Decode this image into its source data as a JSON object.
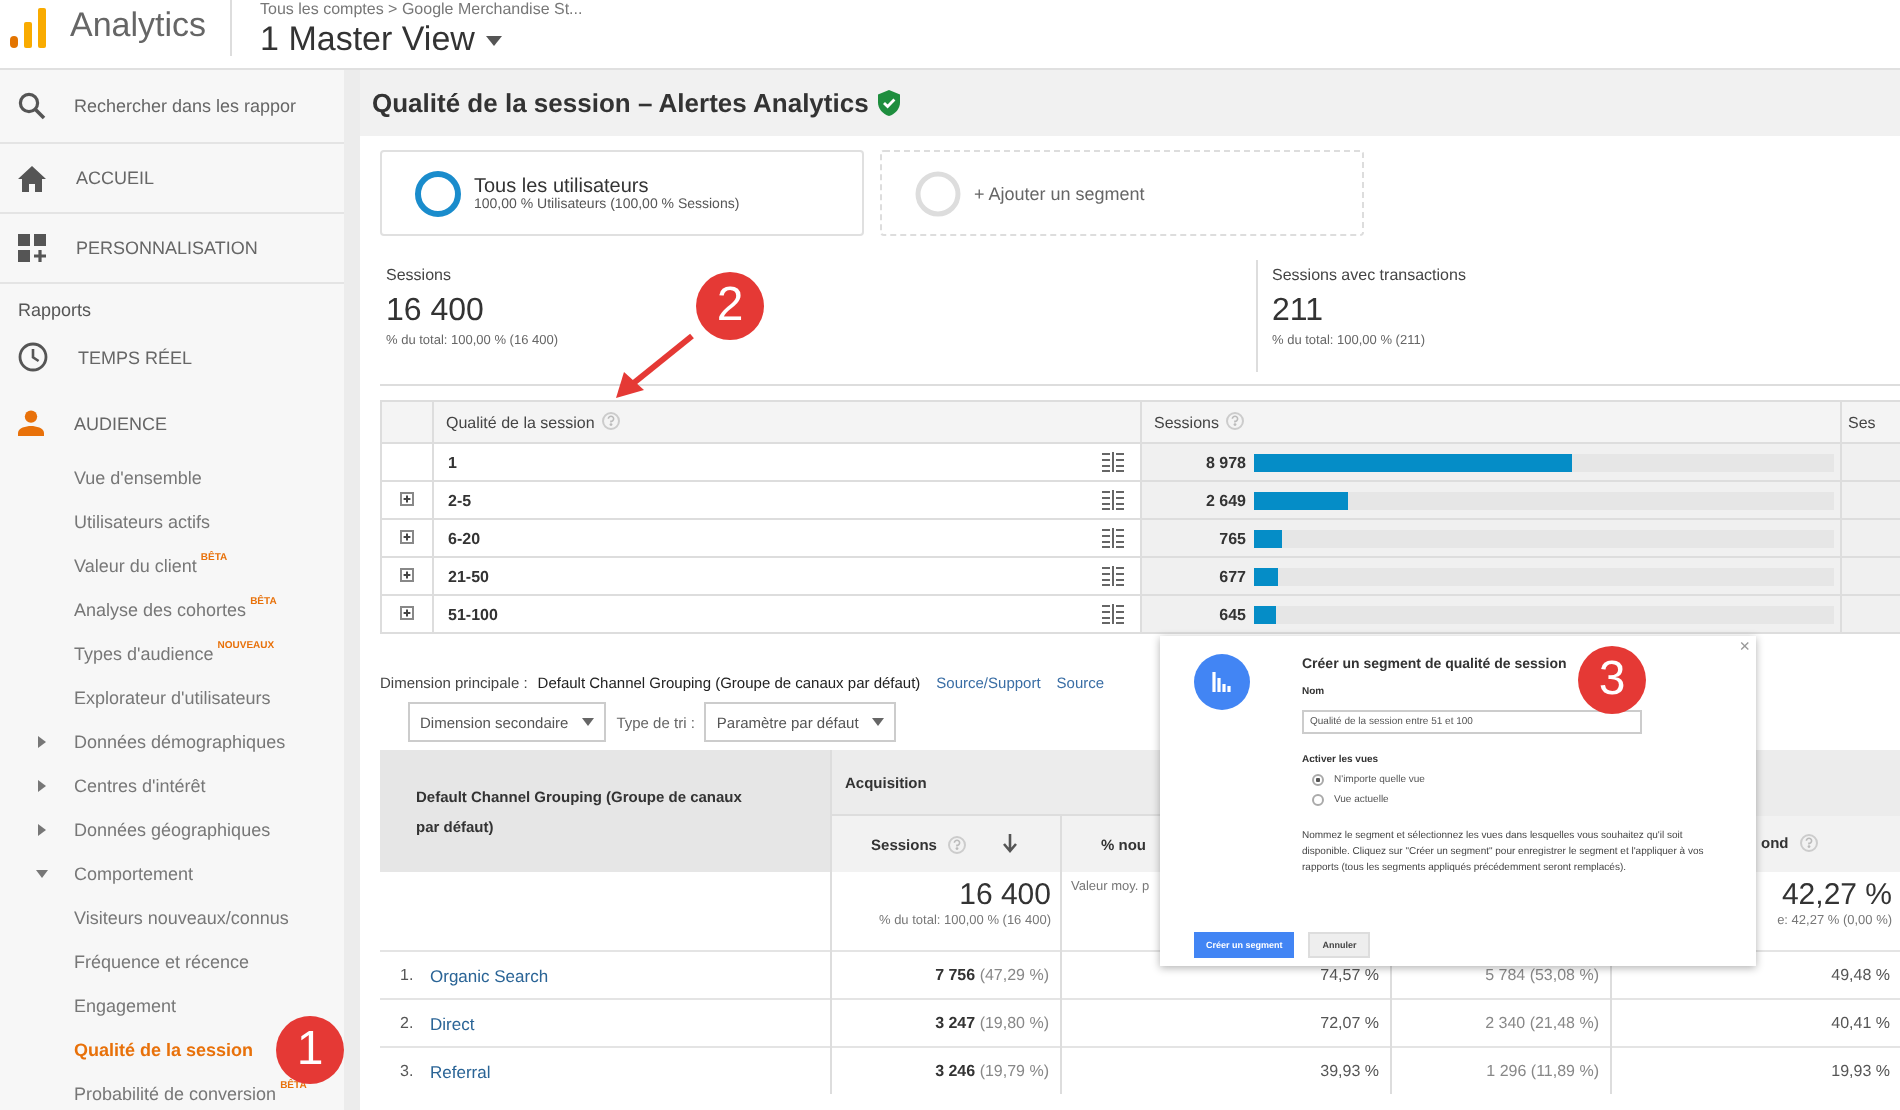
{
  "header": {
    "product": "Analytics",
    "breadcrumb": "Tous les comptes > Google Merchandise St...",
    "view": "1 Master View"
  },
  "sidebar": {
    "search": {
      "placeholder": "Rechercher dans les rappor"
    },
    "top_items": [
      {
        "label": "ACCUEIL",
        "selected": false
      },
      {
        "label": "PERSONNALISATION",
        "selected": false
      }
    ],
    "section_label": "Rapports",
    "report_items": [
      {
        "label": "TEMPS RÉEL",
        "selected": false
      },
      {
        "label": "AUDIENCE",
        "selected": true,
        "children": [
          {
            "label": "Vue d'ensemble",
            "selected": false
          },
          {
            "label": "Utilisateurs actifs",
            "selected": false
          },
          {
            "label": "Valeur du client",
            "badge": "BÊTA",
            "selected": false
          },
          {
            "label": "Analyse des cohortes",
            "badge": "BÊTA",
            "selected": false
          },
          {
            "label": "Types d'audience",
            "badge": "NOUVEAUX",
            "selected": false
          },
          {
            "label": "Explorateur d'utilisateurs",
            "selected": false
          },
          {
            "label": "Données démographiques",
            "expanded": false,
            "selected": false
          },
          {
            "label": "Centres d'intérêt",
            "expanded": false,
            "selected": false
          },
          {
            "label": "Données géographiques",
            "expanded": false,
            "selected": false
          },
          {
            "label": "Comportement",
            "expanded": true,
            "selected": false,
            "children": [
              {
                "label": "Visiteurs nouveaux/connus",
                "selected": false
              },
              {
                "label": "Fréquence et récence",
                "selected": false
              },
              {
                "label": "Engagement",
                "selected": false
              },
              {
                "label": "Qualité de la session",
                "selected": true
              },
              {
                "label": "Probabilité de conversion",
                "badge": "BÊTA",
                "selected": false
              }
            ]
          }
        ]
      }
    ]
  },
  "page_title": "Qualité de la session – Alertes Analytics",
  "segments": [
    {
      "kind": "segment",
      "title": "Tous les utilisateurs",
      "subtitle": "100,00 % Utilisateurs (100,00 % Sessions)"
    },
    {
      "kind": "add",
      "title": "+ Ajouter un segment"
    }
  ],
  "metrics": [
    {
      "label": "Sessions",
      "value": "16 400",
      "note": "% du total: 100,00 % (16 400)"
    },
    {
      "label": "Sessions avec transactions",
      "value": "211",
      "note": "% du total: 100,00 % (211)"
    }
  ],
  "quality_table": {
    "columns": [
      {
        "label": "Qualité de la session",
        "help": true
      },
      {
        "label": "Sessions",
        "help": true
      },
      {
        "label": "Ses"
      }
    ],
    "rows": [
      {
        "label": "1",
        "sessions": "8 978",
        "level": 0.547,
        "expandable": false
      },
      {
        "label": "2-5",
        "sessions": "2 649",
        "level": 0.162,
        "expandable": true
      },
      {
        "label": "6-20",
        "sessions": "765",
        "level": 0.047,
        "expandable": true
      },
      {
        "label": "21-50",
        "sessions": "677",
        "level": 0.041,
        "expandable": true
      },
      {
        "label": "51-100",
        "sessions": "645",
        "level": 0.039,
        "expandable": true
      }
    ]
  },
  "dimension_bar": {
    "label": "Dimension principale :",
    "current": "Default Channel Grouping (Groupe de canaux par défaut)",
    "links": [
      "Source/Support",
      "Source"
    ]
  },
  "controls": {
    "secondary_dimension": "Dimension secondaire",
    "sort_label": "Type de tri :",
    "sort_type": "Paramètre par défaut"
  },
  "channel_table": {
    "dimension_header": "Default Channel Grouping (Groupe de canaux par défaut)",
    "group_header": "Acquisition",
    "columns": [
      {
        "label": "Sessions",
        "help": true,
        "sorted": true
      },
      {
        "label": "% nou"
      },
      {},
      {
        "label": "ond",
        "help": true,
        "sorted": false
      }
    ],
    "totals": [
      {
        "value": "16 400",
        "note": "% du total: 100,00 % (16 400)"
      },
      {
        "note": "Valeur moy. p"
      },
      {
        "value": "42,27 %",
        "note": "e: 42,27 % (0,00 %)"
      }
    ],
    "rows": [
      {
        "rank": "1.",
        "channel": "Organic Search",
        "cells": [
          "**7 756** (47,29 %)",
          "74,57 %",
          "5 784 (53,08 %)",
          "49,48 %"
        ]
      },
      {
        "rank": "2.",
        "channel": "Direct",
        "cells": [
          "**3 247** (19,80 %)",
          "72,07 %",
          "2 340 (21,48 %)",
          "40,41 %"
        ]
      },
      {
        "rank": "3.",
        "channel": "Referral",
        "cells": [
          "**3 246** (19,79 %)",
          "39,93 %",
          "1 296 (11,89 %)",
          "19,93 %"
        ]
      }
    ]
  },
  "dialog": {
    "title": "Créer un segment de qualité de session",
    "close": "×",
    "name_label": "Nom",
    "name_value": "Qualité de la session entre 51 et 100",
    "views_label": "Activer les vues",
    "view_options": [
      {
        "label": "N'importe quelle vue",
        "selected": true
      },
      {
        "label": "Vue actuelle",
        "selected": false
      }
    ],
    "help_text": "Nommez le segment et sélectionnez les vues dans lesquelles vous souhaitez qu'il soit disponible. Cliquez sur \"Créer un segment\" pour enregistrer le segment et l'appliquer à vos rapports (tous les segments appliqués précédemment seront remplacés).",
    "buttons": [
      {
        "label": "Créer un segment",
        "kind": "primary"
      },
      {
        "label": "Annuler",
        "kind": "secondary"
      }
    ]
  },
  "annotations": [
    {
      "number": "1"
    },
    {
      "number": "2"
    },
    {
      "number": "3"
    }
  ]
}
